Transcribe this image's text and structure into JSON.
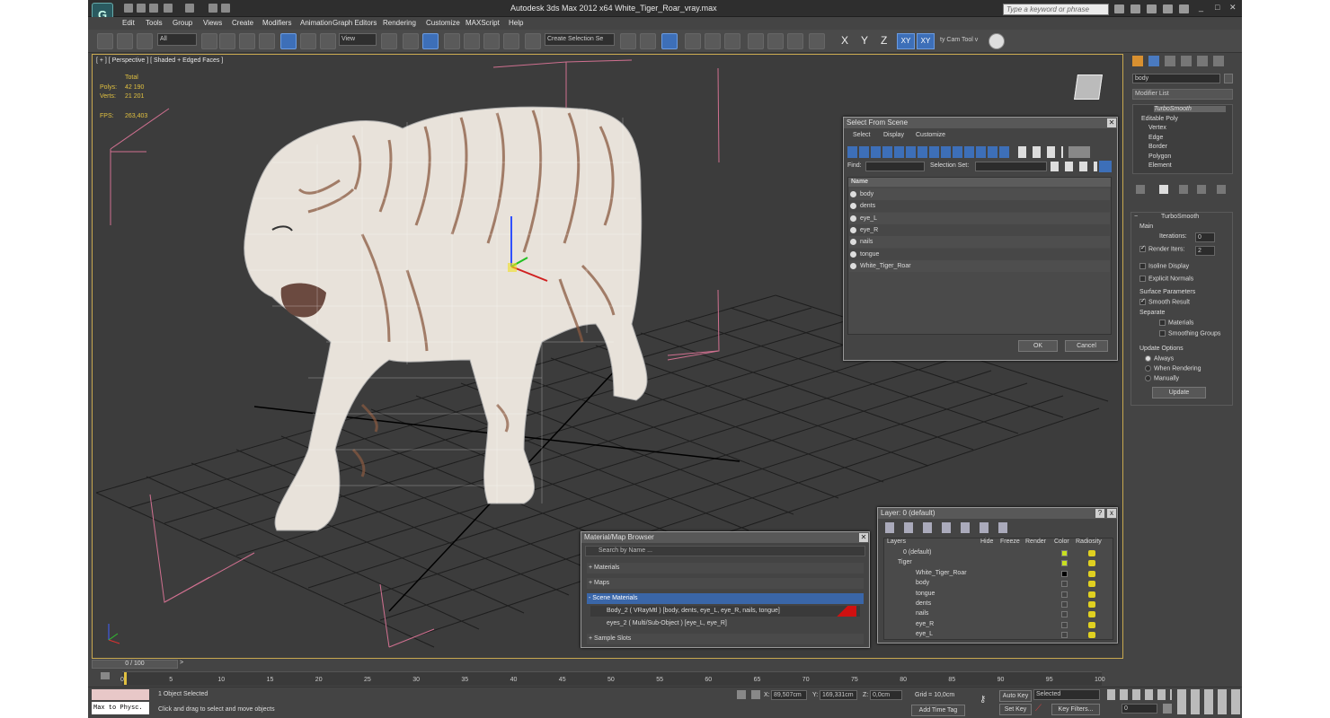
{
  "window": {
    "title": "Autodesk 3ds Max  2012 x64     White_Tiger_Roar_vray.max",
    "search_placeholder": "Type a keyword or phrase"
  },
  "menu": [
    "Edit",
    "Tools",
    "Group",
    "Views",
    "Create",
    "Modifiers",
    "Animation",
    "Graph Editors",
    "Rendering",
    "Customize",
    "MAXScript",
    "Help"
  ],
  "toolbar": {
    "filter_value": "All",
    "coord_value": "View",
    "selection_set_placeholder": "Create Selection Se",
    "axes": [
      "X",
      "Y",
      "Z",
      "XY",
      "XY"
    ],
    "cam_tool": "ty Cam Tool v"
  },
  "viewport": {
    "label": "[ + ] [ Perspective ] [ Shaded + Edged Faces ]",
    "stats": {
      "header": "Total",
      "polys_label": "Polys:",
      "polys_value": "42 190",
      "verts_label": "Verts:",
      "verts_value": "21 201",
      "fps_label": "FPS:",
      "fps_value": "263,403"
    }
  },
  "select_dialog": {
    "title": "Select From Scene",
    "menus": [
      "Select",
      "Display",
      "Customize"
    ],
    "find_label": "Find:",
    "selection_set_label": "Selection Set:",
    "column": "Name",
    "items": [
      "body",
      "dents",
      "eye_L",
      "eye_R",
      "nails",
      "tongue",
      "White_Tiger_Roar"
    ],
    "ok": "OK",
    "cancel": "Cancel"
  },
  "material_browser": {
    "title": "Material/Map Browser",
    "search_placeholder": "Search by Name ...",
    "sections": [
      "+ Materials",
      "+ Maps",
      "- Scene Materials",
      "+ Sample Slots"
    ],
    "materials": [
      "Body_2  ( VRayMtl ) [body, dents, eye_L, eye_R, nails, tongue]",
      "eyes_2  ( Multi/Sub-Object ) [eye_L, eye_R]"
    ]
  },
  "layer_dialog": {
    "title": "Layer: 0 (default)",
    "columns": [
      "Layers",
      "Hide",
      "Freeze",
      "Render",
      "Color",
      "Radiosity"
    ],
    "rows": [
      "0 (default)",
      "Tiger",
      "White_Tiger_Roar",
      "body",
      "tongue",
      "dents",
      "nails",
      "eye_R",
      "eye_L"
    ],
    "close": "x",
    "help": "?"
  },
  "command_panel": {
    "object_name": "body",
    "modifier_list": "Modifier List",
    "stack": [
      "TurboSmooth",
      "Editable Poly",
      "Vertex",
      "Edge",
      "Border",
      "Polygon",
      "Element"
    ],
    "rollout_title": "TurboSmooth",
    "main_label": "Main",
    "iterations_label": "Iterations:",
    "iterations_value": "0",
    "render_iters_label": "Render Iters:",
    "render_iters_value": "2",
    "isoline": "Isoline Display",
    "explicit": "Explicit Normals",
    "surface_params": "Surface Parameters",
    "smooth_result": "Smooth Result",
    "separate": "Separate",
    "materials": "Materials",
    "smoothing_groups": "Smoothing Groups",
    "update_options": "Update Options",
    "always": "Always",
    "when_rendering": "When Rendering",
    "manually": "Manually",
    "update_btn": "Update"
  },
  "timeline": {
    "slider": "0 / 100",
    "ticks": [
      "0",
      "5",
      "10",
      "15",
      "20",
      "25",
      "30",
      "35",
      "40",
      "45",
      "50",
      "55",
      "60",
      "65",
      "70",
      "75",
      "80",
      "85",
      "90",
      "95",
      "100"
    ]
  },
  "status": {
    "maxscript": "Max to Physc.",
    "selected": "1 Object Selected",
    "prompt": "Click and drag to select and move objects",
    "x_label": "X:",
    "x_value": "89,507cm",
    "y_label": "Y:",
    "y_value": "169,331cm",
    "z_label": "Z:",
    "z_value": "0,0cm",
    "grid": "Grid = 10,0cm",
    "add_time_tag": "Add Time Tag",
    "auto_key": "Auto Key",
    "set_key": "Set Key",
    "selected_dropdown": "Selected",
    "key_filters": "Key Filters...",
    "frame": "0"
  }
}
